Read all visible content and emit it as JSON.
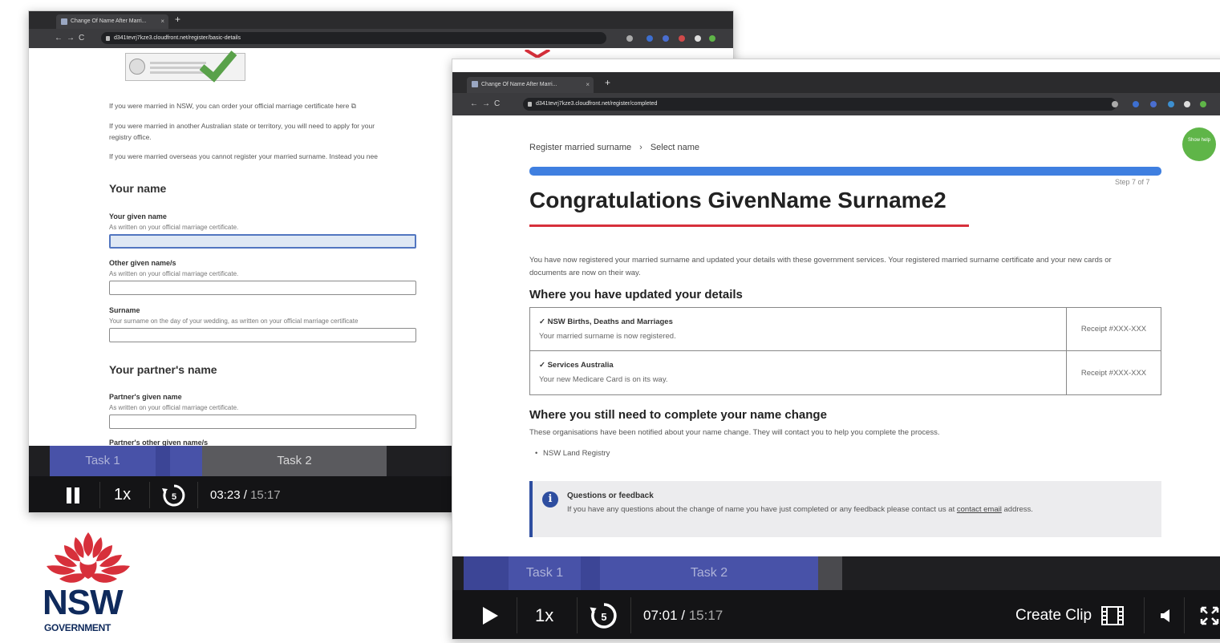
{
  "back_window": {
    "tab_title": "Change Of Name After Marri...",
    "url": "d341tevrj7kze3.cloudfront.net/register/basic-details",
    "paragraphs": [
      "If you were married in NSW, you can order your official marriage certificate here",
      "If you were married in another Australian state or territory, you will need to apply for your",
      "registry office.",
      "If you were married overseas you cannot register your married surname. Instead you nee"
    ],
    "your_name_heading": "Your name",
    "fields": [
      {
        "label": "Your given name",
        "hint": "As written on your official marriage certificate."
      },
      {
        "label": "Other given name/s",
        "hint": "As written on your official marriage certificate."
      },
      {
        "label": "Surname",
        "hint": "Your surname on the day of your wedding, as written on your official marriage certificate"
      }
    ],
    "partner_heading": "Your partner's name",
    "partner_fields": [
      {
        "label": "Partner's given name",
        "hint": "As written on your official marriage certificate."
      },
      {
        "label": "Partner's other given name/s"
      }
    ],
    "player": {
      "task1": "Task 1",
      "task2": "Task 2",
      "speed": "1x",
      "rewind": "5",
      "time_current": "03:23",
      "time_total": "15:17",
      "progress_fraction": 0.22
    }
  },
  "front_window": {
    "tab_title": "Change Of Name After Marri...",
    "url": "d341tevrj7kze3.cloudfront.net/register/completed",
    "help_bubble": "Show help",
    "breadcrumb": [
      "Register married surname",
      "Select name"
    ],
    "step": "Step 7 of 7",
    "progress_fraction": 1.0,
    "title": "Congratulations GivenName Surname2",
    "intro": "You have now registered your married surname and updated your details with these government services. Your registered married surname certificate and your new cards or documents are now on their way.",
    "updated_heading": "Where you have updated your details",
    "updated_rows": [
      {
        "service": "✓ NSW Births, Deaths and Marriages",
        "detail": "Your married surname is now registered.",
        "receipt": "Receipt #XXX-XXX"
      },
      {
        "service": "✓ Services Australia",
        "detail": "Your new Medicare Card is on its way.",
        "receipt": "Receipt #XXX-XXX"
      }
    ],
    "still_heading": "Where you still need to complete your name change",
    "still_sub": "These organisations have been notified about your name change. They will contact you to help you complete the process.",
    "still_items": [
      "NSW Land Registry"
    ],
    "feedback_title": "Questions or feedback",
    "feedback_body": "If you have any questions about the change of name you have just completed or any feedback please contact us at",
    "feedback_link": "contact email",
    "feedback_tail": "address.",
    "player": {
      "task1": "Task 1",
      "task2": "Task 2",
      "speed": "1x",
      "rewind": "5",
      "time_current": "07:01",
      "time_total": "15:17",
      "create_clip": "Create Clip",
      "progress_fraction": 0.46
    }
  },
  "logo": {
    "word": "NSW",
    "sub": "GOVERNMENT"
  },
  "colors": {
    "nsw_navy": "#0f2a5c",
    "nsw_red": "#d7303b",
    "progress_blue": "#3f7fe0",
    "task_blue": "#4852a8",
    "check_green": "#59a14a"
  }
}
